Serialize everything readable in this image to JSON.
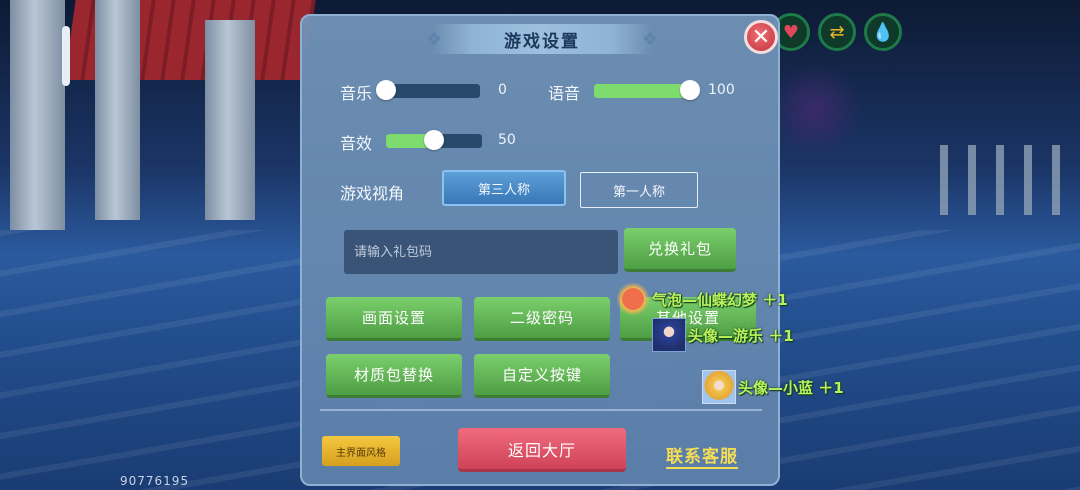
{
  "hud": {
    "icons": [
      "heart-icon",
      "swap-icon",
      "water-drop-icon"
    ],
    "user_id": "90776195"
  },
  "dialog": {
    "title": "游戏设置",
    "close_glyph": "✕",
    "music": {
      "label": "音乐",
      "value": 0
    },
    "voice": {
      "label": "语音",
      "value": 100
    },
    "sfx": {
      "label": "音效",
      "value": 50
    },
    "view": {
      "label": "游戏视角",
      "options": [
        "第三人称",
        "第一人称"
      ],
      "selected": "第三人称"
    },
    "gift": {
      "placeholder": "请输入礼包码",
      "redeem_label": "兑换礼包"
    },
    "buttons": {
      "graphics": "画面设置",
      "second_password": "二级密码",
      "other": "其他设置",
      "texture_pack": "材质包替换",
      "custom_keys": "自定义按键"
    },
    "footer": {
      "style_label": "主界面风格",
      "lobby_label": "返回大厅",
      "service_label": "联系客服"
    }
  },
  "notifications": [
    {
      "text": "气泡—仙蝶幻梦 ＋1",
      "icon": "crab-bubble-icon"
    },
    {
      "text": "头像—游乐 ＋1",
      "icon": "avatar-blue-icon"
    },
    {
      "text": "头像—小蓝 ＋1",
      "icon": "avatar-blonde-icon"
    }
  ],
  "colors": {
    "slider_fill": "#7edb6e",
    "slider_track": "#27496b",
    "green_button": "#5ab050",
    "red_button": "#d94d62",
    "link": "#f4dd55",
    "notice_text": "#b9f25b"
  }
}
